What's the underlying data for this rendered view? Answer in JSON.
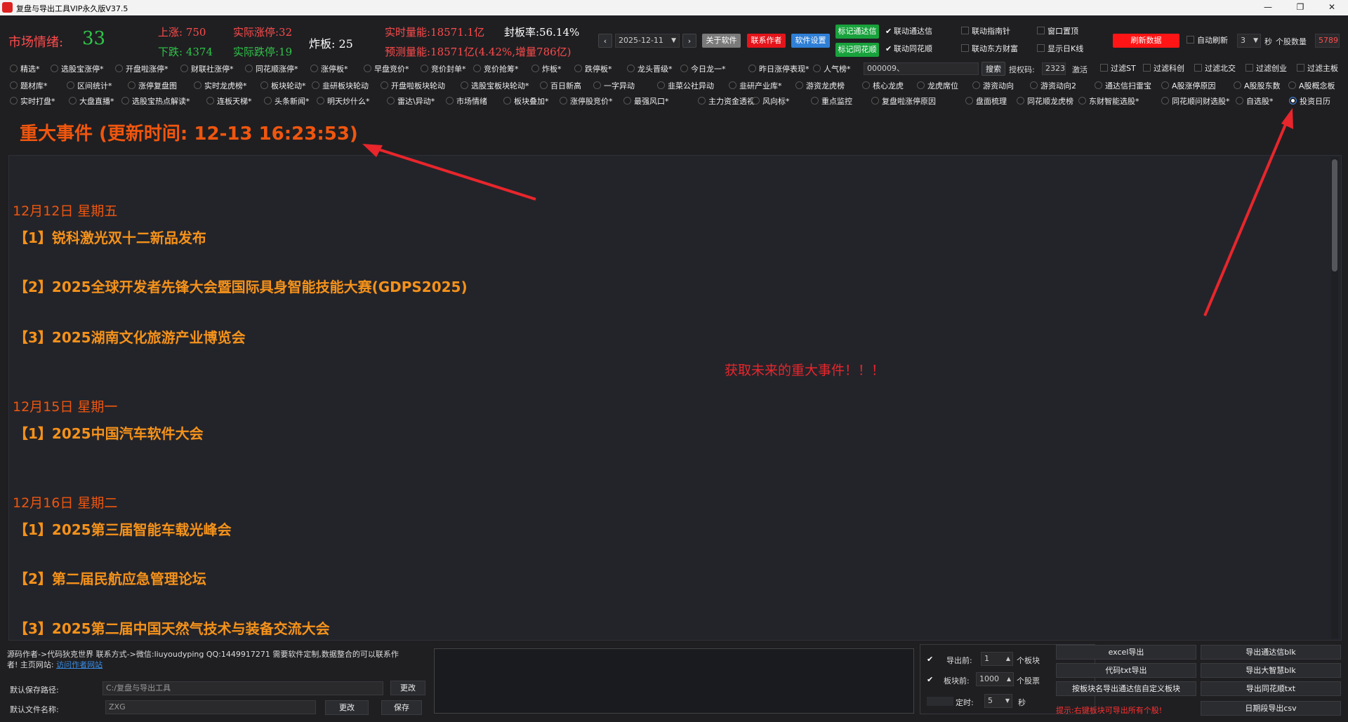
{
  "window": {
    "title": "复盘与导出工具VIP永久版V37.5"
  },
  "stats": {
    "market_label": "市场情绪:",
    "market_value": "33",
    "up": "上涨: 750",
    "up_limit": "实际涨停:32",
    "down": "下跌: 4374",
    "down_limit": "实际跌停:19",
    "break": "炸板: 25",
    "volume": "实时量能:18571.1亿",
    "seal_rate": "封板率:56.14%",
    "forecast": "预测量能:18571亿(4.42%,增量786亿)"
  },
  "toolbar": {
    "prev": "‹",
    "date": "2025-12-11",
    "next": "›",
    "about": "关于软件",
    "contact": "联系作者",
    "settings": "软件设置",
    "mark_tdx": "标记通达信",
    "mark_ths": "标记同花顺",
    "link_tdx": "联动通达信",
    "link_ths": "联动同花顺",
    "link_compass": "联动指南针",
    "link_east": "联动东方财富",
    "pin_window": "窗口置顶",
    "show_kline": "显示日K线",
    "refresh": "刷新数据",
    "auto_refresh": "自动刷新",
    "interval": "3",
    "sec_label": "秒",
    "count_label": "个股数量",
    "count": "5789"
  },
  "row1": [
    "精选*",
    "选股宝涨停*",
    "开盘啦涨停*",
    "财联社涨停*",
    "同花顺涨停*",
    "涨停板*",
    "早盘竞价*",
    "竞价封单*",
    "竞价抢筹*",
    "炸板*",
    "跌停板*",
    "龙头晋级*",
    "今日龙一*",
    "昨日涨停表现*",
    "人气榜*"
  ],
  "row1_extra": {
    "code_value": "000009、",
    "search": "搜索",
    "auth_label": "授权码:",
    "auth_value": "2323",
    "activate": "激活",
    "filters": [
      "过滤ST",
      "过滤科创",
      "过滤北交",
      "过滤创业",
      "过滤主板"
    ]
  },
  "row2": [
    "题材库*",
    "区间统计*",
    "涨停复盘图",
    "实时龙虎榜*",
    "板块轮动*",
    "韭研板块轮动",
    "开盘啦板块轮动",
    "选股宝板块轮动*",
    "百日新高",
    "一字异动",
    "韭菜公社异动",
    "韭研产业库*",
    "游资龙虎榜",
    "核心龙虎",
    "龙虎席位",
    "游资动向",
    "游资动向2",
    "通达信扫雷宝",
    "A股涨停原因",
    "A股股东数",
    "A股概念板"
  ],
  "row3": [
    "实时打盘*",
    "大盘直播*",
    "选股宝热点解读*",
    "连板天梯*",
    "头条新闻*",
    "明天炒什么*",
    "雷达\\异动*",
    "市场情绪",
    "板块叠加*",
    "涨停股竞价*",
    "最强风口*",
    "主力资金透视*",
    "风向标*",
    "重点监控",
    "复盘啦涨停原因",
    "盘面梳理",
    "同花顺龙虎榜",
    "东财智能选股*",
    "同花顺问财选股*",
    "自选股*",
    "投资日历"
  ],
  "selected_tab": "投资日历",
  "header": {
    "title": "重大事件 (更新时间: 12-13 16:23:53)"
  },
  "annotation": "获取未来的重大事件！！！",
  "events": [
    {
      "date": "12月12日 星期五",
      "items": [
        "【1】锐科激光双十二新品发布",
        "【2】2025全球开发者先锋大会暨国际具身智能技能大赛(GDPS2025)",
        "【3】2025湖南文化旅游产业博览会"
      ]
    },
    {
      "date": "12月15日 星期一",
      "items": [
        "【1】2025中国汽车软件大会"
      ]
    },
    {
      "date": "12月16日 星期二",
      "items": [
        "【1】2025第三届智能车载光峰会",
        "【2】第二届民航应急管理论坛",
        "【3】2025第二届中国天然气技术与装备交流大会"
      ]
    }
  ],
  "footer": {
    "author_line1": "源码作者->代码狄克世界 联系方式->微信:liuyoudyping QQ:1449917271 需要软件定制,数据整合的可以联系作",
    "author_line2": "者! 主页网站: ",
    "author_link": "访问作者网站",
    "save_path_label": "默认保存路径:",
    "save_path": "C:/复盘与导出工具",
    "change": "更改",
    "file_name_label": "默认文件名称:",
    "file_name": "ZXG",
    "change2": "更改",
    "save": "保存",
    "export_top_label": "导出前:",
    "export_top_value": "1",
    "export_top_unit": "个板块",
    "block_top_label": "板块前:",
    "block_top_value": "1000",
    "block_top_unit": "个股票",
    "timer_label": "定时:",
    "timer_value": "5",
    "timer_unit": "秒",
    "btn_excel": "excel导出",
    "btn_code_txt": "代码txt导出",
    "btn_block_tdx": "按板块名导出通达信自定义板块",
    "btn_tdx_blk": "导出通达信blk",
    "btn_dzh_blk": "导出大智慧blk",
    "btn_ths_txt": "导出同花顺txt",
    "btn_date_csv": "日期段导出csv",
    "hint": "提示:右键板块可导出所有个股!"
  },
  "colors": {
    "bg": "#1f1f22",
    "accent_red": "#ff4b4b",
    "accent_green": "#2fc548",
    "event_orange": "#f5921a",
    "date_orange": "#f0560e",
    "arrow": "#e8262c"
  }
}
